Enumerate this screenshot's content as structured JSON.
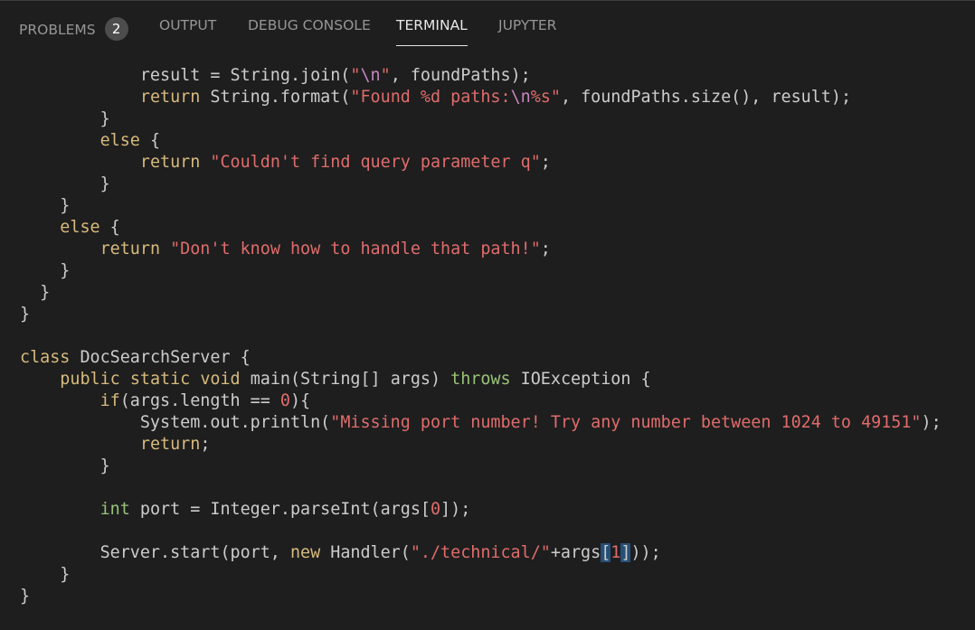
{
  "tabs": [
    {
      "label": "PROBLEMS",
      "badge": "2"
    },
    {
      "label": "OUTPUT"
    },
    {
      "label": "DEBUG CONSOLE"
    },
    {
      "label": "TERMINAL",
      "active": true
    },
    {
      "label": "JUPYTER"
    }
  ],
  "code": {
    "lines": [
      "            result = String.join(\"\\n\", foundPaths);",
      "            return String.format(\"Found %d paths:\\n%s\", foundPaths.size(), result);",
      "        }",
      "        else {",
      "            return \"Couldn't find query parameter q\";",
      "        }",
      "    }",
      "    else {",
      "        return \"Don't know how to handle that path!\";",
      "    }",
      "  }",
      "}",
      "",
      "class DocSearchServer {",
      "    public static void main(String[] args) throws IOException {",
      "        if(args.length == 0){",
      "            System.out.println(\"Missing port number! Try any number between 1024 to 49151\");",
      "            return;",
      "        }",
      "",
      "        int port = Integer.parseInt(args[0]);",
      "",
      "        Server.start(port, new Handler(\"./technical/\"+args[1]));",
      "    }",
      "}"
    ]
  },
  "colors": {
    "background": "#1e1e1e",
    "keyword": "#d7ba7d",
    "string": "#e06c6c",
    "type_keyword": "#98c379",
    "escape": "#c586c0"
  }
}
